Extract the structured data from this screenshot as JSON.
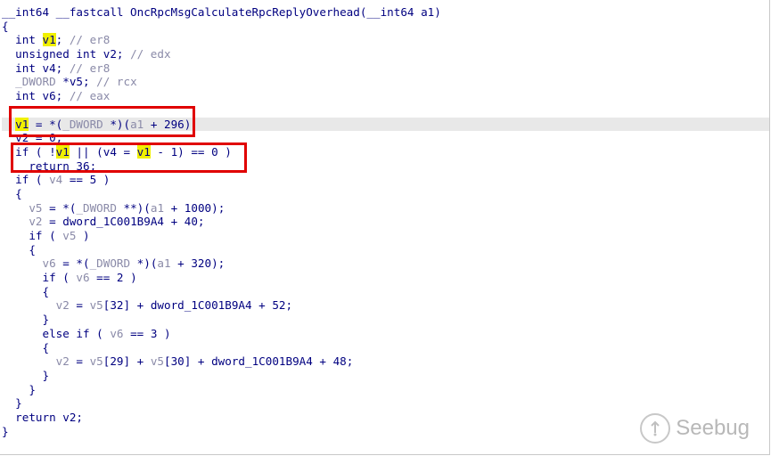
{
  "code_lines": [
    {
      "id": "l0",
      "parts": [
        [
          "kw",
          "__int64 __fastcall OncRpcMsgCalculateRpcReplyOverhead(__int64 a1)"
        ]
      ]
    },
    {
      "id": "l1",
      "parts": [
        [
          "kw",
          "{"
        ]
      ]
    },
    {
      "id": "l2",
      "parts": [
        [
          "kw",
          "  int "
        ],
        [
          "hl",
          "v1"
        ],
        [
          "kw",
          "; "
        ],
        [
          "dim",
          "// er8"
        ]
      ]
    },
    {
      "id": "l3",
      "parts": [
        [
          "kw",
          "  unsigned int v2; "
        ],
        [
          "dim",
          "// edx"
        ]
      ]
    },
    {
      "id": "l4",
      "parts": [
        [
          "kw",
          "  int v4; "
        ],
        [
          "dim",
          "// er8"
        ]
      ]
    },
    {
      "id": "l5",
      "parts": [
        [
          "dim",
          "  _DWORD "
        ],
        [
          "kw",
          "*v5; "
        ],
        [
          "dim",
          "// rcx"
        ]
      ]
    },
    {
      "id": "l6",
      "parts": [
        [
          "kw",
          "  int v6; "
        ],
        [
          "dim",
          "// eax"
        ]
      ]
    },
    {
      "id": "l7",
      "parts": [
        [
          "kw",
          ""
        ]
      ]
    },
    {
      "id": "l8",
      "current": true,
      "parts": [
        [
          "kw",
          "  "
        ],
        [
          "hl",
          "v1"
        ],
        [
          "kw",
          " = *("
        ],
        [
          "dim",
          "_DWORD "
        ],
        [
          "kw",
          "*)("
        ],
        [
          "dim",
          "a1"
        ],
        [
          "kw",
          " + 296);"
        ]
      ]
    },
    {
      "id": "l9",
      "parts": [
        [
          "kw",
          "  v2 = 0;"
        ]
      ]
    },
    {
      "id": "l10",
      "parts": [
        [
          "kw",
          "  if ( !"
        ],
        [
          "hl",
          "v1"
        ],
        [
          "kw",
          " || (v4 = "
        ],
        [
          "hl",
          "v1"
        ],
        [
          "kw",
          " - 1) == 0 )"
        ]
      ]
    },
    {
      "id": "l11",
      "parts": [
        [
          "kw",
          "    return 36;"
        ]
      ]
    },
    {
      "id": "l12",
      "parts": [
        [
          "kw",
          "  if ( "
        ],
        [
          "dim",
          "v4"
        ],
        [
          "kw",
          " == 5 )"
        ]
      ]
    },
    {
      "id": "l13",
      "parts": [
        [
          "kw",
          "  {"
        ]
      ]
    },
    {
      "id": "l14",
      "parts": [
        [
          "kw",
          "    "
        ],
        [
          "dim",
          "v5"
        ],
        [
          "kw",
          " = *("
        ],
        [
          "dim",
          "_DWORD "
        ],
        [
          "kw",
          "**)("
        ],
        [
          "dim",
          "a1"
        ],
        [
          "kw",
          " + 1000);"
        ]
      ]
    },
    {
      "id": "l15",
      "parts": [
        [
          "kw",
          "    "
        ],
        [
          "dim",
          "v2"
        ],
        [
          "kw",
          " = dword_1C001B9A4 + 40;"
        ]
      ]
    },
    {
      "id": "l16",
      "parts": [
        [
          "kw",
          "    if ( "
        ],
        [
          "dim",
          "v5"
        ],
        [
          "kw",
          " )"
        ]
      ]
    },
    {
      "id": "l17",
      "parts": [
        [
          "kw",
          "    {"
        ]
      ]
    },
    {
      "id": "l18",
      "parts": [
        [
          "kw",
          "      "
        ],
        [
          "dim",
          "v6"
        ],
        [
          "kw",
          " = *("
        ],
        [
          "dim",
          "_DWORD "
        ],
        [
          "kw",
          "*)("
        ],
        [
          "dim",
          "a1"
        ],
        [
          "kw",
          " + 320);"
        ]
      ]
    },
    {
      "id": "l19",
      "parts": [
        [
          "kw",
          "      if ( "
        ],
        [
          "dim",
          "v6"
        ],
        [
          "kw",
          " == 2 )"
        ]
      ]
    },
    {
      "id": "l20",
      "parts": [
        [
          "kw",
          "      {"
        ]
      ]
    },
    {
      "id": "l21",
      "parts": [
        [
          "kw",
          "        "
        ],
        [
          "dim",
          "v2"
        ],
        [
          "kw",
          " = "
        ],
        [
          "dim",
          "v5"
        ],
        [
          "kw",
          "[32] + dword_1C001B9A4 + 52;"
        ]
      ]
    },
    {
      "id": "l22",
      "parts": [
        [
          "kw",
          "      }"
        ]
      ]
    },
    {
      "id": "l23",
      "parts": [
        [
          "kw",
          "      else if ( "
        ],
        [
          "dim",
          "v6"
        ],
        [
          "kw",
          " == 3 )"
        ]
      ]
    },
    {
      "id": "l24",
      "parts": [
        [
          "kw",
          "      {"
        ]
      ]
    },
    {
      "id": "l25",
      "parts": [
        [
          "kw",
          "        "
        ],
        [
          "dim",
          "v2"
        ],
        [
          "kw",
          " = "
        ],
        [
          "dim",
          "v5"
        ],
        [
          "kw",
          "[29] + "
        ],
        [
          "dim",
          "v5"
        ],
        [
          "kw",
          "[30] + dword_1C001B9A4 + 48;"
        ]
      ]
    },
    {
      "id": "l26",
      "parts": [
        [
          "kw",
          "      }"
        ]
      ]
    },
    {
      "id": "l27",
      "parts": [
        [
          "kw",
          "    }"
        ]
      ]
    },
    {
      "id": "l28",
      "parts": [
        [
          "kw",
          "  }"
        ]
      ]
    },
    {
      "id": "l29",
      "parts": [
        [
          "kw",
          "  return v2;"
        ]
      ]
    },
    {
      "id": "l30",
      "parts": [
        [
          "kw",
          "}"
        ]
      ]
    }
  ],
  "watermark": {
    "text": "Seebug",
    "icon": "seebug-logo-icon"
  },
  "colors": {
    "highlight": "#f0f000",
    "annotation": "#e00000",
    "current_line": "#e8e8e8"
  }
}
